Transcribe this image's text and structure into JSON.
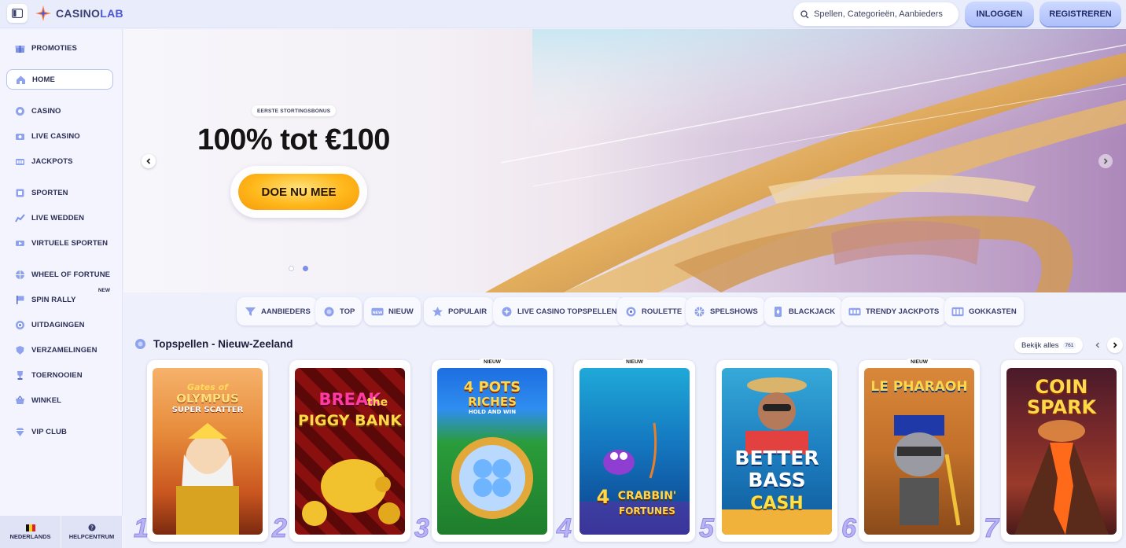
{
  "header": {
    "logo_text": "CASINO",
    "logo_text_accent": "LAB",
    "search_placeholder": "Spellen, Categorieën, Aanbieders",
    "login_label": "INLOGGEN",
    "register_label": "REGISTREREN"
  },
  "sidebar": {
    "items": [
      {
        "label": "PROMOTIES",
        "icon": "gift-icon"
      },
      {
        "label": "HOME",
        "icon": "home-icon",
        "active": true
      },
      {
        "label": "CASINO",
        "icon": "chip-icon"
      },
      {
        "label": "LIVE CASINO",
        "icon": "live-icon"
      },
      {
        "label": "JACKPOTS",
        "icon": "jackpot-icon"
      },
      {
        "label": "SPORTEN",
        "icon": "sport-icon"
      },
      {
        "label": "LIVE WEDDEN",
        "icon": "live-bet-icon"
      },
      {
        "label": "VIRTUELE SPORTEN",
        "icon": "virtual-icon"
      },
      {
        "label": "WHEEL OF FORTUNE",
        "icon": "wheel-icon"
      },
      {
        "label": "SPIN RALLY",
        "icon": "flag-icon",
        "badge": "NEW"
      },
      {
        "label": "UITDAGINGEN",
        "icon": "target-icon"
      },
      {
        "label": "VERZAMELINGEN",
        "icon": "shield-icon"
      },
      {
        "label": "TOERNOOIEN",
        "icon": "trophy-icon"
      },
      {
        "label": "WINKEL",
        "icon": "basket-icon"
      },
      {
        "label": "VIP CLUB",
        "icon": "diamond-icon"
      }
    ],
    "language_label": "NEDERLANDS",
    "help_label": "HELPCENTRUM"
  },
  "hero": {
    "tag": "EERSTE STORTINGSBONUS",
    "title": "100% tot €100",
    "cta_label": "DOE NU MEE"
  },
  "categories": [
    {
      "label": "AANBIEDERS",
      "icon": "providers-icon"
    },
    {
      "label": "TOP",
      "icon": "top-icon"
    },
    {
      "label": "NIEUW",
      "icon": "new-icon"
    },
    {
      "label": "POPULAIR",
      "icon": "star-icon"
    },
    {
      "label": "LIVE CASINO TOPSPELLEN",
      "icon": "live-casino-icon"
    },
    {
      "label": "ROULETTE",
      "icon": "roulette-icon"
    },
    {
      "label": "SPELSHOWS",
      "icon": "gameshow-icon"
    },
    {
      "label": "BLACKJACK",
      "icon": "cards-icon"
    },
    {
      "label": "TRENDY JACKPOTS",
      "icon": "jackpot-icon"
    },
    {
      "label": "GOKKASTEN",
      "icon": "slots-icon"
    }
  ],
  "section": {
    "title": "Topspellen - Nieuw-Zeeland",
    "view_all_label": "Bekijk alles",
    "view_all_count": "761"
  },
  "games": [
    {
      "rank": "1",
      "title_line1": "Gates of",
      "title_line2": "OLYMPUS",
      "title_line3": "SUPER SCATTER",
      "tag": ""
    },
    {
      "rank": "2",
      "title_line1": "BREAK",
      "title_line2": "the",
      "title_line3": "PIGGY BANK",
      "tag": ""
    },
    {
      "rank": "3",
      "title_line1": "4 POTS",
      "title_line2": "RICHES",
      "title_line3": "HOLD AND WIN",
      "tag": "NIEUW"
    },
    {
      "rank": "4",
      "title_line1": "4",
      "title_line2": "CRABBIN'",
      "title_line3": "FORTUNES",
      "tag": "NIEUW"
    },
    {
      "rank": "5",
      "title_line1": "BETTER",
      "title_line2": "BASS",
      "title_line3": "CASH",
      "tag": ""
    },
    {
      "rank": "6",
      "title_line1": "LE PHARAOH",
      "title_line2": "",
      "title_line3": "",
      "tag": "NIEUW"
    },
    {
      "rank": "7",
      "title_line1": "COIN",
      "title_line2": "SPARK",
      "title_line3": "",
      "tag": ""
    }
  ]
}
